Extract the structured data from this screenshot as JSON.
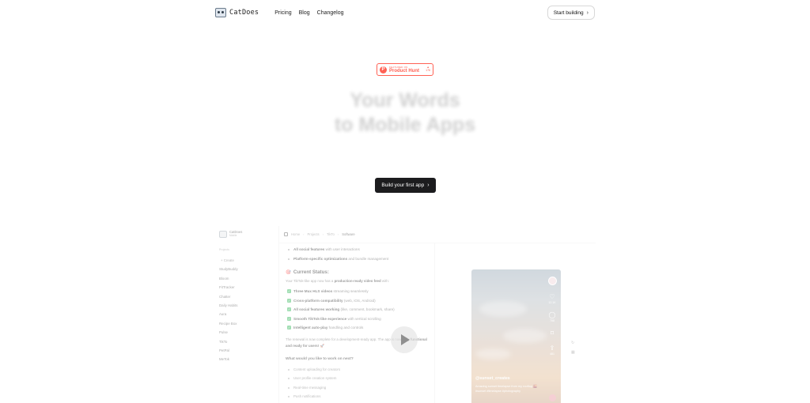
{
  "nav": {
    "brand": "CatDoes",
    "links": [
      "Pricing",
      "Blog",
      "Changelog"
    ],
    "cta": "Start building"
  },
  "producthunt": {
    "small": "FEATURED ON",
    "label": "Product Hunt",
    "votes": "176"
  },
  "hero": {
    "line1": "Your Words",
    "line2": "to Mobile Apps",
    "cta": "Build your first app"
  },
  "preview": {
    "sidebar": {
      "brand": "CatDoes",
      "brand_sub": "Mobile",
      "heading": "Projects",
      "items": [
        "+ Create",
        "StudyBuddy",
        "Bloom",
        "FitTracker",
        "Chatter",
        "Daily Habits",
        "Aura",
        "Recipe Box",
        "Pulse",
        "TikTo",
        "PetPal",
        "MeTok"
      ]
    },
    "breadcrumb": [
      "Home",
      "Projects",
      "TikTo",
      "Software"
    ],
    "chat": {
      "bullets": [
        {
          "bold": "All social features",
          "rest": " with user interactions"
        },
        {
          "bold": "Platform-specific optimizations",
          "rest": " and bundle management"
        }
      ],
      "status_emoji": "🎯",
      "status_title": "Current Status:",
      "status_pre": "Your TikTok-like app now has a ",
      "status_bold": "production-ready video feed",
      "status_post": " with:",
      "checks": [
        {
          "bold": "Three Mux HLS videos",
          "rest": " streaming seamlessly"
        },
        {
          "bold": "Cross-platform compatibility",
          "rest": " (web, iOS, Android)"
        },
        {
          "bold": "All social features working",
          "rest": " (like, comment, bookmark, share)"
        },
        {
          "bold": "Smooth TikTok-like experience",
          "rest": " with vertical scrolling"
        },
        {
          "bold": "Intelligent auto-play",
          "rest": " handling and controls"
        }
      ],
      "summary_pre": "The renewal is now complete for a development-ready app. The app is now ",
      "summary_bold": "fully functional and ready for users!",
      "summary_emoji": "🚀",
      "question": "What would you like to work on next?",
      "options": [
        "Content uploading for creators",
        "User profile creation system",
        "Real-time messaging",
        "Push notifications"
      ]
    },
    "phone": {
      "likes": "12.1K",
      "comments": "758",
      "shares": "481",
      "username": "@sunset_creates",
      "caption": "Amazing sunset timelapse from my rooftop 🌇 #sunset #timelapse #photography"
    }
  }
}
